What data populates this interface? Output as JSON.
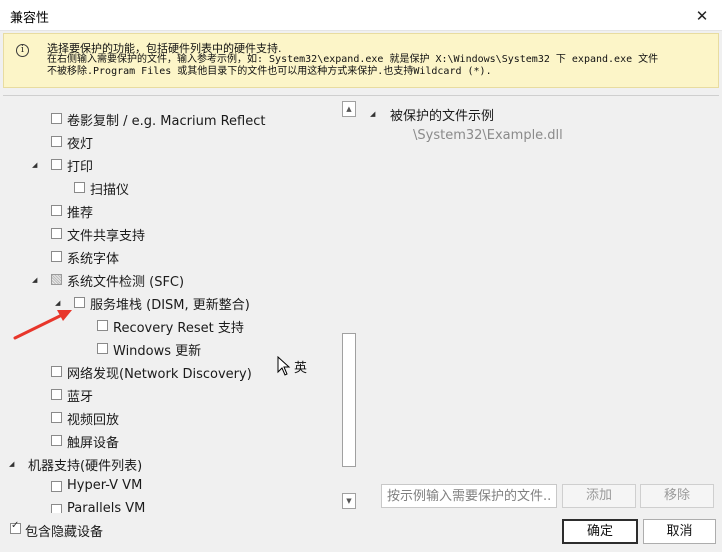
{
  "window": {
    "title": "兼容性"
  },
  "info": {
    "line1": "选择要保护的功能，包括硬件列表中的硬件支持.",
    "line2": "在右侧输入需要保护的文件，输入参考示例，如: System32\\expand.exe 就是保护 X:\\Windows\\System32 下 expand.exe 文件",
    "line3": "不被移除.Program Files 或其他目录下的文件也可以用这种方式来保护.也支持Wildcard (*)."
  },
  "tree": {
    "items": [
      {
        "label": "卷影复制 / e.g. Macrium Reflect",
        "checked": false,
        "expanded": null
      },
      {
        "label": "夜灯",
        "checked": false,
        "expanded": null
      },
      {
        "label": "打印",
        "checked": false,
        "expanded": true
      },
      {
        "label": "扫描仪",
        "checked": false,
        "expanded": null
      },
      {
        "label": "推荐",
        "checked": false,
        "expanded": null
      },
      {
        "label": "文件共享支持",
        "checked": false,
        "expanded": null
      },
      {
        "label": "系统字体",
        "checked": false,
        "expanded": null
      },
      {
        "label": "系统文件检测 (SFC)",
        "checked": "partial",
        "expanded": true
      },
      {
        "label": "服务堆栈 (DISM, 更新整合)",
        "checked": false,
        "expanded": true
      },
      {
        "label": "Recovery Reset 支持",
        "checked": false,
        "expanded": null
      },
      {
        "label": "Windows 更新",
        "checked": false,
        "expanded": null
      },
      {
        "label": "网络发现(Network Discovery)",
        "checked": false,
        "expanded": null
      },
      {
        "label": "蓝牙",
        "checked": false,
        "expanded": null
      },
      {
        "label": "视频回放",
        "checked": false,
        "expanded": null
      },
      {
        "label": "触屏设备",
        "checked": false,
        "expanded": null
      },
      {
        "label": "机器支持(硬件列表)",
        "checked": null,
        "expanded": true
      },
      {
        "label": "Hyper-V VM",
        "checked": false,
        "expanded": null
      },
      {
        "label": "Parallels VM",
        "checked": false,
        "expanded": null
      }
    ]
  },
  "protected": {
    "title": "被保护的文件示例",
    "example": "\\System32\\Example.dll"
  },
  "pattern": {
    "placeholder": "按示例输入需要保护的文件...",
    "add_label": "添加",
    "remove_label": "移除"
  },
  "ime_indicator": "英",
  "include_hidden": {
    "label": "包含隐藏设备",
    "checked": true
  },
  "ok_label": "确定",
  "cancel_label": "取消",
  "colors": {
    "info_bg": "#fcf5c8",
    "annotation_arrow": "#e8362b"
  }
}
